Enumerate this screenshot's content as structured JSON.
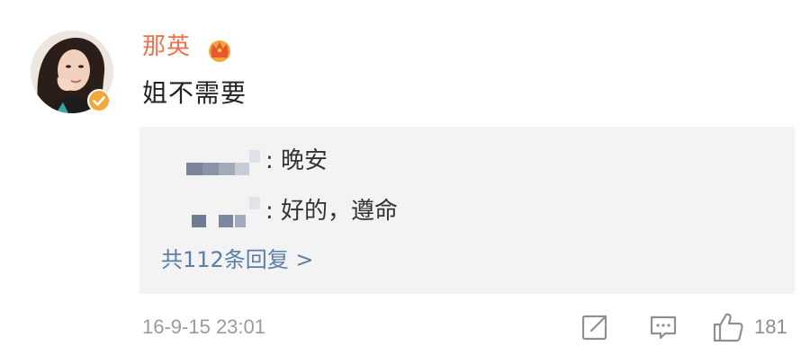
{
  "comment": {
    "username": "那英",
    "text": "姐不需要",
    "timestamp": "16-9-15 23:01",
    "like_count": "181"
  },
  "replies": [
    {
      "text": ": 晚安"
    },
    {
      "text": ": 好的，遵命"
    }
  ],
  "more_replies_label": "共112条回复 >",
  "icons": {
    "avatar": "user-avatar",
    "verified": "verified-badge-icon",
    "crown": "crown-icon",
    "forward": "forward-icon",
    "comment": "comment-icon",
    "like": "thumbs-up-icon"
  },
  "colors": {
    "username": "#eb7350",
    "link": "#5a7ea8",
    "meta": "#9b9b9b",
    "reply_bg": "#f3f3f3",
    "badge": "#f2a93b"
  }
}
